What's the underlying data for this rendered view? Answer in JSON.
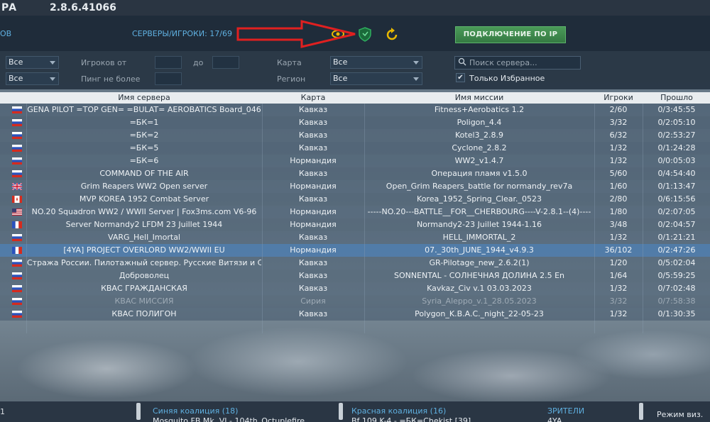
{
  "title": {
    "partial": "РА",
    "version": "2.8.6.41066"
  },
  "topbar": {
    "left_label": "ОВ",
    "server_count": "СЕРВЕРЫ/ИГРОКИ: 17/69",
    "connect_ip": "ПОДКЛЮЧЕНИЕ ПО IP"
  },
  "filters": {
    "row1_select": "Все",
    "row2_select": "Все",
    "players_from": "Игроков от",
    "to": "до",
    "ping_max": "Пинг не более",
    "map_label": "Карта",
    "map_value": "Все",
    "region_label": "Регион",
    "region_value": "Все",
    "search_placeholder": "Поиск сервера...",
    "favorites_only": "Только Избранное",
    "favorites_checked": true
  },
  "columns": [
    "Имя сервера",
    "Карта",
    "Имя миссии",
    "Игроки",
    "Прошло"
  ],
  "rows": [
    {
      "flag": "ru",
      "name": "GENA PILOT =TOP GEN= =BULAT= AEROBATICS Board_046",
      "map": "Кавказ",
      "mission": "Fitness+Aerobatics 1.2",
      "players": "2/60",
      "elapsed": "0/3:45:55"
    },
    {
      "flag": "ru",
      "name": "=БК=1",
      "map": "Кавказ",
      "mission": "Poligon_4.4",
      "players": "3/32",
      "elapsed": "0/2:05:10"
    },
    {
      "flag": "ru",
      "name": "=БК=2",
      "map": "Кавказ",
      "mission": "Kotel3_2.8.9",
      "players": "6/32",
      "elapsed": "0/2:53:27"
    },
    {
      "flag": "ru",
      "name": "=БК=5",
      "map": "Кавказ",
      "mission": "Cyclone_2.8.2",
      "players": "1/32",
      "elapsed": "0/1:24:28"
    },
    {
      "flag": "ru",
      "name": "=БК=6",
      "map": "Нормандия",
      "mission": "WW2_v1.4.7",
      "players": "1/32",
      "elapsed": "0/0:05:03"
    },
    {
      "flag": "ru",
      "name": "COMMAND OF THE AIR",
      "map": "Кавказ",
      "mission": "Операция пламя v1.5.0",
      "players": "5/60",
      "elapsed": "0/4:54:40"
    },
    {
      "flag": "uk",
      "name": "Grim Reapers WW2 Open server",
      "map": "Нормандия",
      "mission": "Open_Grim Reapers_battle for normandy_rev7a",
      "players": "1/60",
      "elapsed": "0/1:13:47"
    },
    {
      "flag": "ca",
      "name": "MVP KOREA 1952 Combat Server",
      "map": "Кавказ",
      "mission": "Korea_1952_Spring_Clear._0523",
      "players": "2/80",
      "elapsed": "0/6:15:56"
    },
    {
      "flag": "us",
      "name": "NO.20 Squadron WW2 / WWII Server | Fox3ms.com V6-96",
      "map": "Нормандия",
      "mission": "-----NO.20---BATTLE__FOR__CHERBOURG----V-2.8.1--(4)----",
      "players": "1/80",
      "elapsed": "0/2:07:05"
    },
    {
      "flag": "fr",
      "name": "Server Normandy2 LFDM 23 Juillet 1944",
      "map": "Нормандия",
      "mission": "Normandy2-23 Juillet 1944-1.16",
      "players": "3/48",
      "elapsed": "0/2:04:57"
    },
    {
      "flag": "ru",
      "name": "VARG_Hell_Imortal",
      "map": "Кавказ",
      "mission": "HELL_IMMORTAL_2",
      "players": "1/32",
      "elapsed": "0/1:21:21"
    },
    {
      "flag": "fr",
      "name": "[4YA] PROJECT OVERLORD WW2/WWII EU",
      "map": "Нормандия",
      "mission": "07._30th_JUNE_1944_v4.9.3",
      "players": "36/102",
      "elapsed": "0/2:47:26"
    },
    {
      "flag": "ru",
      "name": "Стража России. Пилотажный сервер. Русские Витязи и Стри",
      "map": "Кавказ",
      "mission": "GR-Pilotage_new_2.6.2(1)",
      "players": "1/20",
      "elapsed": "0/5:02:04"
    },
    {
      "flag": "ru",
      "name": "Доброволец",
      "map": "Кавказ",
      "mission": "SONNENTAL - СОЛНЕЧНАЯ ДОЛИНА 2.5 En",
      "players": "1/64",
      "elapsed": "0/5:59:25"
    },
    {
      "flag": "ru",
      "name": "КВАС ГРАЖДАНСКАЯ",
      "map": "Кавказ",
      "mission": "Kavkaz_Civ v.1 03.03.2023",
      "players": "1/32",
      "elapsed": "0/7:02:48"
    },
    {
      "flag": "ru",
      "name": "КВАС МИССИЯ",
      "map": "Сирия",
      "mission": "Syria_Aleppo_v.1_28.05.2023",
      "players": "3/32",
      "elapsed": "0/7:58:38"
    },
    {
      "flag": "ru",
      "name": "КВАС ПОЛИГОН",
      "map": "Кавказ",
      "mission": "Polygon_K.B.A.C._night_22-05-23",
      "players": "1/32",
      "elapsed": "0/1:30:35"
    }
  ],
  "bottom": {
    "left_num": "1",
    "blue": "Синяя коалиция (18)",
    "red": "Красная коалиция (16)",
    "spectators": "ЗРИТЕЛИ",
    "view_mode": "Режим виз. ра",
    "blue_item": "Mosquito FB Mk. VI - 104th_Octuplefire",
    "red_item": "Bf 109 K-4 - =БК=Chekist [39]",
    "spec_item": "4YA"
  },
  "colors": {
    "accent": "#5fb0e0",
    "connect_green": "#4a9a58",
    "arrow_red": "#e02020",
    "selected_row": "#4678af"
  }
}
